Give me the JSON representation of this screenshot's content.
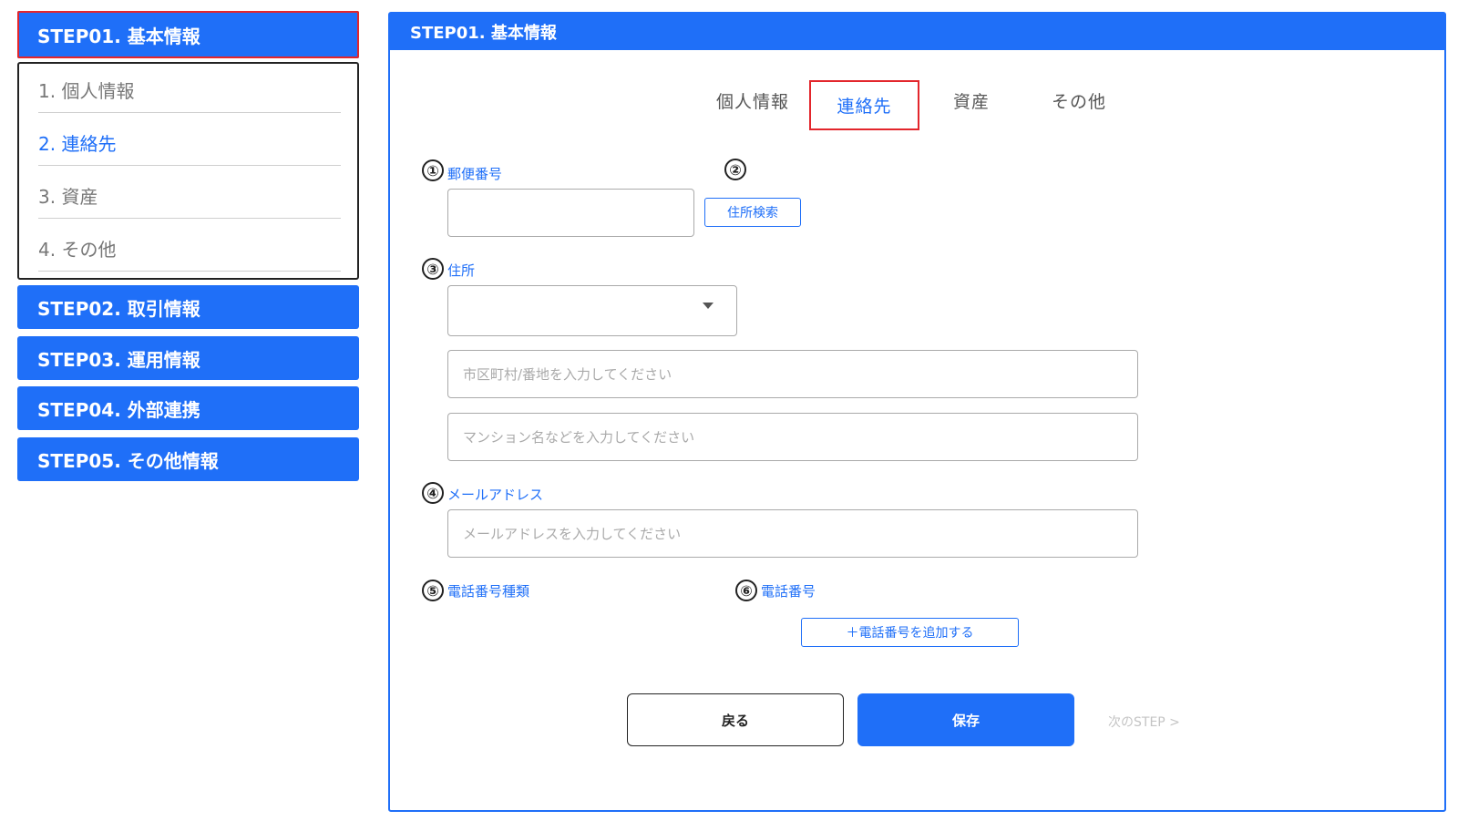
{
  "sidebar": {
    "step1": "STEP01. 基本情報",
    "sub_items": [
      "1. 個人情報",
      "2. 連絡先",
      "3. 資産",
      "4. その他"
    ],
    "step2": "STEP02. 取引情報",
    "step3": "STEP03. 運用情報",
    "step4": "STEP04. 外部連携",
    "step5": "STEP05. その他情報"
  },
  "panel": {
    "title": "STEP01. 基本情報",
    "tabs": [
      "個人情報",
      "連絡先",
      "資産",
      "その他"
    ]
  },
  "form": {
    "markers": [
      "①",
      "②",
      "③",
      "④",
      "⑤",
      "⑥"
    ],
    "postal_label": "郵便番号",
    "address_search_button": "住所検索",
    "address_label": "住所",
    "city_placeholder": "市区町村/番地を入力してください",
    "building_placeholder": "マンション名などを入力してください",
    "email_label": "メールアドレス",
    "email_placeholder": "メールアドレスを入力してください",
    "phone_type_label": "電話番号種類",
    "phone_label": "電話番号",
    "add_phone_button": "＋電話番号を追加する"
  },
  "footer": {
    "back": "戻る",
    "save": "保存",
    "next": "次のSTEP >"
  },
  "colors": {
    "primary": "#1f6ff8",
    "highlight": "#e3262c"
  }
}
